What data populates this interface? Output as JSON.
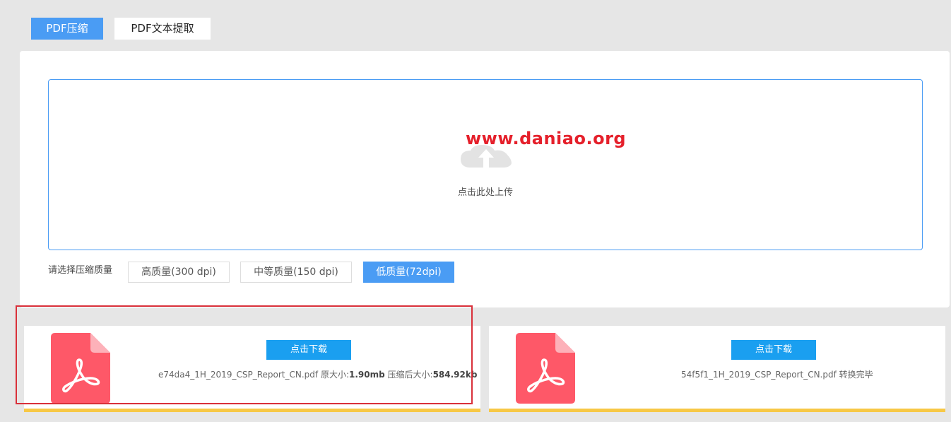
{
  "tabs": [
    {
      "label": "PDF压缩",
      "active": true
    },
    {
      "label": "PDF文本提取",
      "active": false
    }
  ],
  "upload": {
    "watermark": "www.daniao.org",
    "hint": "点击此处上传"
  },
  "quality": {
    "label": "请选择压缩质量",
    "options": [
      {
        "label": "高质量(300 dpi)",
        "selected": false
      },
      {
        "label": "中等质量(150 dpi)",
        "selected": false
      },
      {
        "label": "低质量(72dpi)",
        "selected": true
      }
    ]
  },
  "results": [
    {
      "download_label": "点击下载",
      "filename": "e74da4_1H_2019_CSP_Report_CN.pdf",
      "orig_label": "原大小:",
      "orig_size": "1.90mb",
      "compressed_label": "压缩后大小:",
      "compressed_size": "584.92kb"
    },
    {
      "download_label": "点击下载",
      "filename": "54f5f1_1H_2019_CSP_Report_CN.pdf",
      "status": "转换完毕"
    }
  ],
  "colors": {
    "accent": "#4a9cf4",
    "download": "#1a9ff0",
    "pdf_icon": "#fe5868",
    "card_bar": "#f7c846",
    "highlight": "#d9303a",
    "watermark": "#e5202b"
  },
  "icons": {
    "upload": "cloud-upload-icon",
    "pdf": "pdf-file-icon"
  }
}
